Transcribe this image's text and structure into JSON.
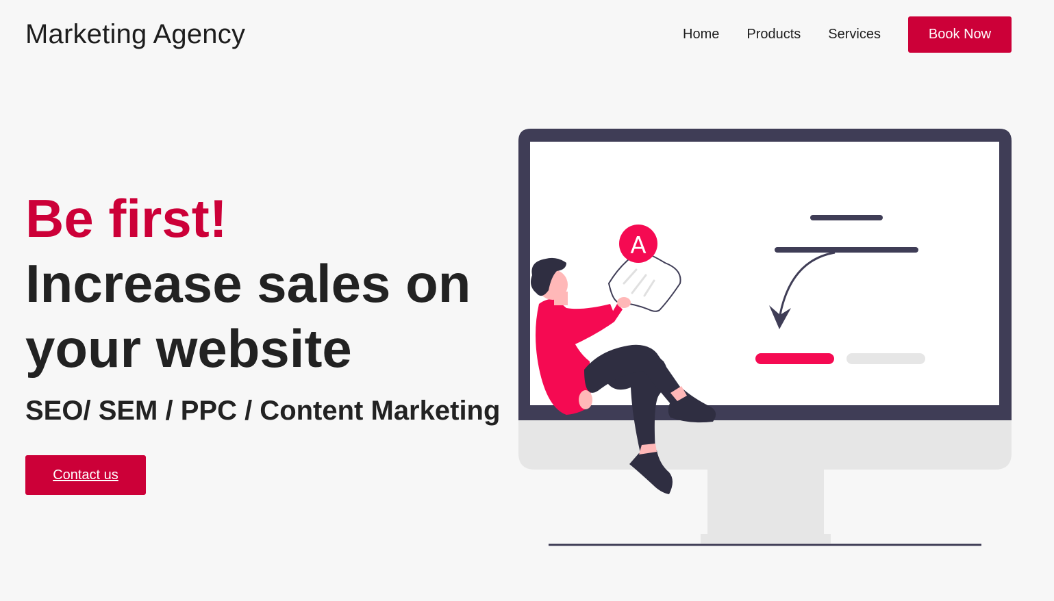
{
  "header": {
    "brand": "Marketing Agency",
    "nav": [
      "Home",
      "Products",
      "Services"
    ],
    "book_label": "Book Now"
  },
  "hero": {
    "accent": "Be first!",
    "title_line1": "Increase sales on",
    "title_line2": "your website",
    "services": "SEO/ SEM / PPC / Content Marketing",
    "cta": "Contact us"
  },
  "illustration": {
    "badge_letter": "A",
    "accent_color": "#cc0038",
    "figure_color": "#f50a52",
    "frame_color": "#3f3d56"
  }
}
